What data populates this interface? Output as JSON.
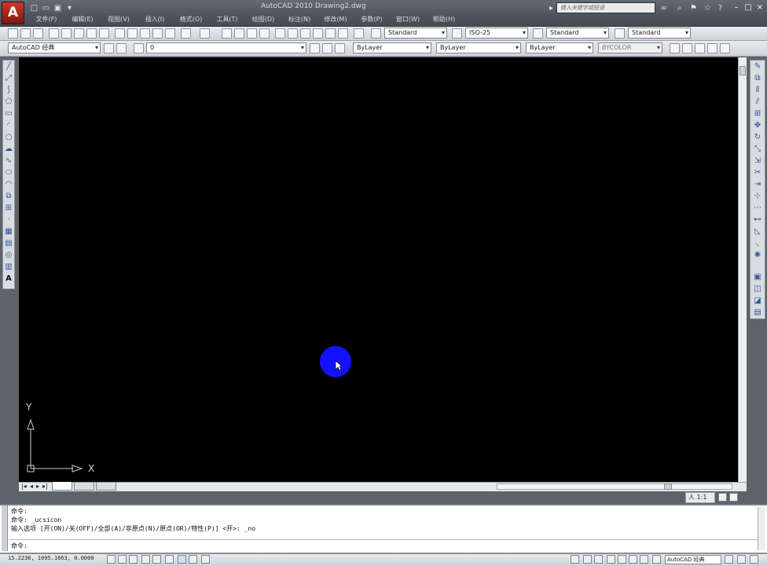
{
  "window": {
    "title": "AutoCAD 2010   Drawing2.dwg"
  },
  "menus": [
    "文件(F)",
    "编辑(E)",
    "视图(V)",
    "插入(I)",
    "格式(O)",
    "工具(T)",
    "绘图(D)",
    "标注(N)",
    "修改(M)",
    "参数(P)",
    "窗口(W)",
    "帮助(H)"
  ],
  "search": {
    "placeholder": "键入关键字或短语"
  },
  "toolbar_styles": {
    "text_style": "Standard",
    "dim_style": "ISO-25",
    "table_style": "Standard",
    "multileader_style": "Standard"
  },
  "workspace": {
    "name": "AutoCAD 经典"
  },
  "layer": {
    "current": "0"
  },
  "properties": {
    "color": "ByLayer",
    "linetype": "ByLayer",
    "lineweight": "ByLayer",
    "plotstyle": "BYCOLOR"
  },
  "ucs": {
    "y": "Y",
    "x": "X"
  },
  "command": {
    "lines": [
      "命令:",
      "命令:  _ucsicon",
      "输入选项 [开(ON)/关(OFF)/全部(A)/非原点(N)/原点(OR)/特性(P)] <开>: _no"
    ],
    "prompt": "命令:"
  },
  "status": {
    "coordinates": "15.2236,   1095.1663,  0.0000",
    "annotation_scale": "人 1:1",
    "workspace_label": "AutoCAD 经典"
  },
  "colors": {
    "canvas": "#000000",
    "cursor_highlight": "#1212ff",
    "title_bar": "#545a63"
  }
}
